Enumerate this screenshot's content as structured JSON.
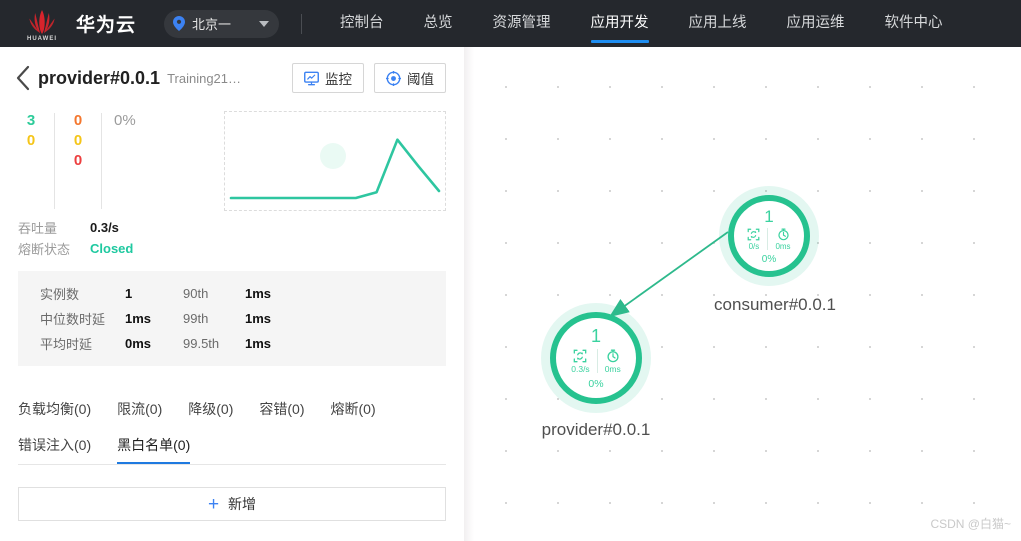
{
  "topnav": {
    "brand": "华为云",
    "brand_logo_word": "HUAWEI",
    "region": {
      "label": "北京一",
      "icon": "location-pin-icon",
      "chevron": "chevron-down-icon"
    },
    "items": [
      {
        "label": "控制台",
        "active": false
      },
      {
        "label": "总览",
        "active": false
      },
      {
        "label": "资源管理",
        "active": false
      },
      {
        "label": "应用开发",
        "active": true
      },
      {
        "label": "应用上线",
        "active": false
      },
      {
        "label": "应用运维",
        "active": false
      },
      {
        "label": "软件中心",
        "active": false
      }
    ],
    "active_color": "#1f8ef1"
  },
  "panel": {
    "back_icon": "back-chevron-icon",
    "title": "provider#0.0.1",
    "subtitle": "Training21…",
    "buttons": [
      {
        "label": "监控",
        "icon": "monitor-icon"
      },
      {
        "label": "阈值",
        "icon": "target-icon"
      }
    ],
    "counts": {
      "col1": [
        {
          "value": "3",
          "color": "#2ecc9a"
        },
        {
          "value": "0",
          "color": "#f5c518"
        }
      ],
      "col2": [
        {
          "value": "0",
          "color": "#f4772e"
        },
        {
          "value": "0",
          "color": "#f5c518"
        },
        {
          "value": "0",
          "color": "#ed3f3f"
        }
      ],
      "percent": "0%"
    },
    "kv": [
      {
        "label": "吞吐量",
        "value": "0.3/s",
        "accent": false
      },
      {
        "label": "熔断状态",
        "value": "Closed",
        "accent": true
      }
    ],
    "metrics": [
      {
        "label": "实例数",
        "value": "1",
        "pct_label": "90th",
        "pct_value": "1ms"
      },
      {
        "label": "中位数时延",
        "value": "1ms",
        "pct_label": "99th",
        "pct_value": "1ms"
      },
      {
        "label": "平均时延",
        "value": "0ms",
        "pct_label": "99.5th",
        "pct_value": "1ms"
      }
    ],
    "tabs": [
      {
        "label": "负载均衡(0)",
        "active": false
      },
      {
        "label": "限流(0)",
        "active": false
      },
      {
        "label": "降级(0)",
        "active": false
      },
      {
        "label": "容错(0)",
        "active": false
      },
      {
        "label": "熔断(0)",
        "active": false
      },
      {
        "label": "错误注入(0)",
        "active": false
      },
      {
        "label": "黑白名单(0)",
        "active": true
      }
    ],
    "add_button": {
      "plus": "+",
      "label": "新增",
      "icon": "plus-icon"
    }
  },
  "chart_data": {
    "type": "line",
    "title": "",
    "xlabel": "",
    "ylabel": "",
    "x": [
      0,
      1,
      2,
      3,
      4,
      5,
      6,
      7,
      8,
      9,
      10
    ],
    "values": [
      0,
      0,
      0,
      0,
      0,
      0,
      0,
      0.1,
      1.0,
      0.55,
      0.12
    ],
    "line_color": "#2ec6a0",
    "ylim": [
      0,
      1.2
    ],
    "grid": false,
    "legend": "none"
  },
  "graph": {
    "nodes": [
      {
        "id": "consumer",
        "label": "consumer#0.0.1",
        "count": "1",
        "throughput": "0/s",
        "latency": "0ms",
        "percent": "0%",
        "throughput_icon": "throughput-icon",
        "latency_icon": "clock-icon",
        "color": "#26c28f"
      },
      {
        "id": "provider",
        "label": "provider#0.0.1",
        "count": "1",
        "throughput": "0.3/s",
        "latency": "0ms",
        "percent": "0%",
        "throughput_icon": "throughput-icon",
        "latency_icon": "clock-icon",
        "color": "#26c28f"
      }
    ],
    "edge": {
      "from": "consumer",
      "to": "provider",
      "color": "#2eb98c",
      "arrow": true
    }
  },
  "watermark": "CSDN @白猫~"
}
